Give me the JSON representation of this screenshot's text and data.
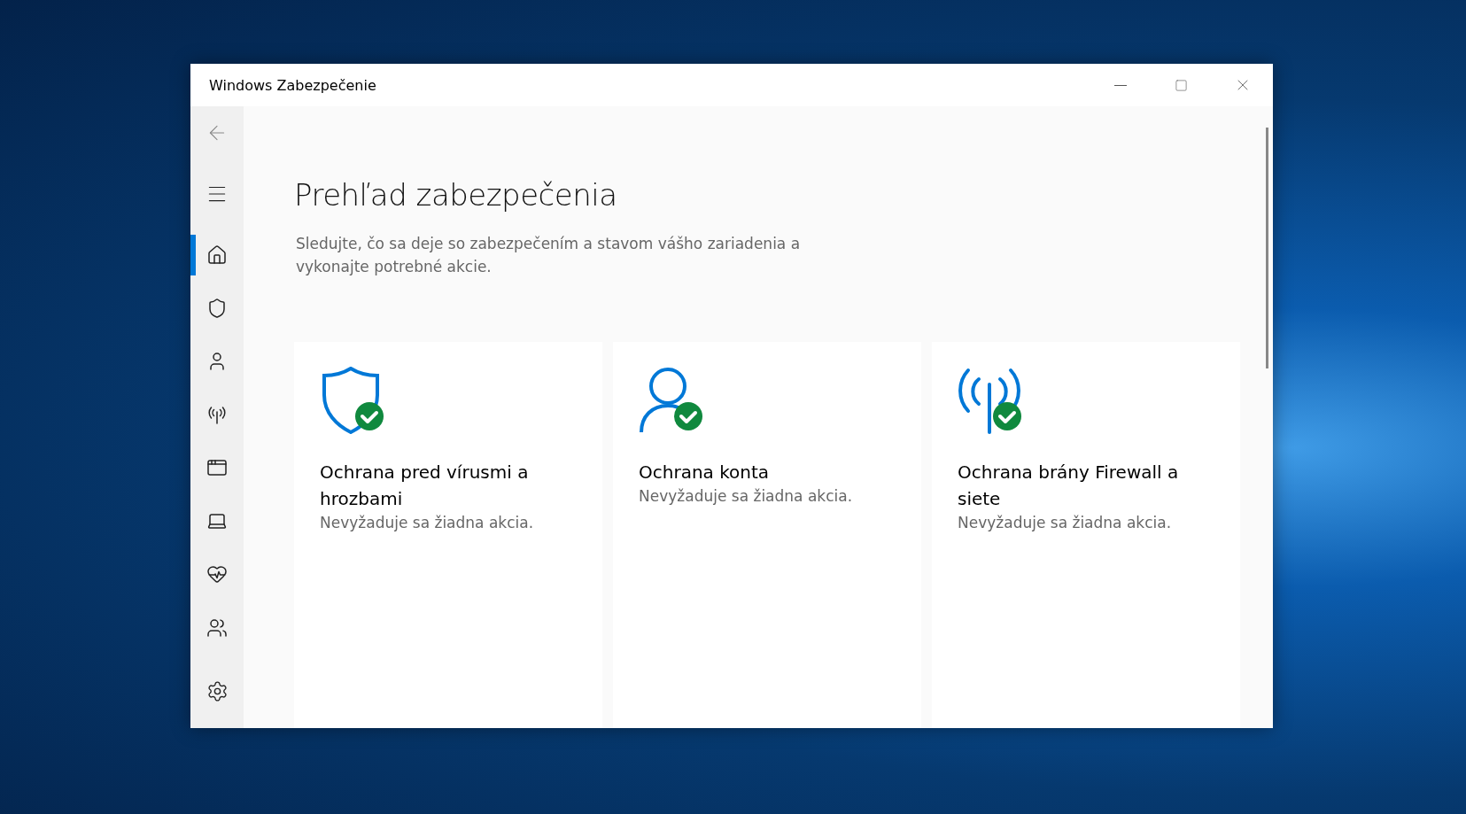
{
  "window": {
    "title": "Windows Zabezpečenie"
  },
  "nav_items": [
    {
      "selected": true
    },
    {
      "selected": false
    },
    {
      "selected": false
    },
    {
      "selected": false
    },
    {
      "selected": false
    },
    {
      "selected": false
    },
    {
      "selected": false
    },
    {
      "selected": false
    }
  ],
  "page": {
    "heading": "Prehľad zabezpečenia",
    "description": "Sledujte, čo sa deje so zabezpečením a stavom vášho zariadenia a vykonajte potrebné akcie."
  },
  "cards": [
    {
      "title": "Ochrana pred vírusmi a hrozbami",
      "protected": true,
      "message": "Nevyžaduje sa žiadna akcia."
    },
    {
      "title": "Ochrana konta",
      "protected": true,
      "message": "Nevyžaduje sa žiadna akcia."
    },
    {
      "title": "Ochrana brány Firewall a siete",
      "protected": true,
      "message": "Nevyžaduje sa žiadna akcia."
    }
  ]
}
